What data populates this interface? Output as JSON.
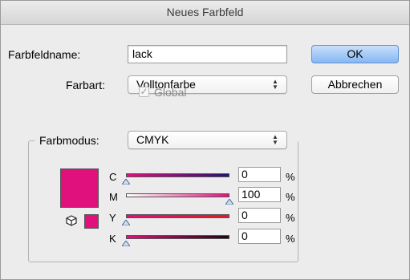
{
  "dialog": {
    "title": "Neues Farbfeld",
    "swatch_name_label": "Farbfeldname:",
    "swatch_name_value": "lack",
    "color_type_label": "Farbart:",
    "color_type_value": "Volltonfarbe",
    "global_label": "Global",
    "global_checked": true,
    "global_disabled": true,
    "color_mode_label": "Farbmodus:",
    "color_mode_value": "CMYK",
    "ok_label": "OK",
    "cancel_label": "Abbrechen",
    "preview_color": "#e0107c",
    "channels": [
      {
        "label": "C",
        "value": "0",
        "unit": "%"
      },
      {
        "label": "M",
        "value": "100",
        "unit": "%"
      },
      {
        "label": "Y",
        "value": "0",
        "unit": "%"
      },
      {
        "label": "K",
        "value": "0",
        "unit": "%"
      }
    ]
  }
}
